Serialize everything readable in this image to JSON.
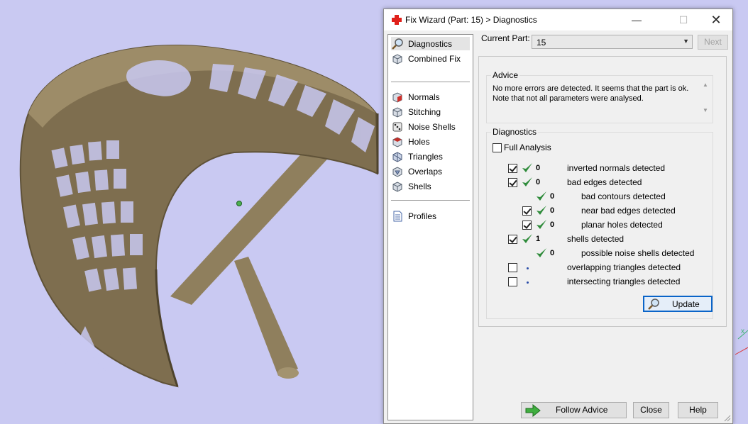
{
  "viewport": {
    "background": "#c9c9f2",
    "model_color": "#8a7a5a"
  },
  "dialog": {
    "title": "Fix Wizard (Part: 15) > Diagnostics",
    "icon": "red-cross-icon"
  },
  "nav": {
    "items": [
      {
        "label": "Diagnostics",
        "icon": "magnifier-icon",
        "selected": true
      },
      {
        "label": "Combined Fix",
        "icon": "cube-stack-icon"
      },
      {
        "label": "Normals",
        "icon": "cube-red-face-icon"
      },
      {
        "label": "Stitching",
        "icon": "cube-stitch-icon"
      },
      {
        "label": "Noise Shells",
        "icon": "dice-icon"
      },
      {
        "label": "Holes",
        "icon": "cube-hole-icon"
      },
      {
        "label": "Triangles",
        "icon": "triangle-cube-icon"
      },
      {
        "label": "Overlaps",
        "icon": "overlap-cube-icon"
      },
      {
        "label": "Shells",
        "icon": "shell-cube-icon"
      },
      {
        "label": "Profiles",
        "icon": "document-icon"
      }
    ]
  },
  "current_part": {
    "label": "Current Part:",
    "value": "15",
    "next_label": "Next"
  },
  "advice": {
    "title": "Advice",
    "text": "No more errors are detected. It seems that the part is ok.\nNote that not all parameters were analysed."
  },
  "diagnostics": {
    "title": "Diagnostics",
    "full_analysis_label": "Full Analysis",
    "full_analysis_checked": false,
    "rows": [
      {
        "checked": true,
        "ok": true,
        "count": "0",
        "label": "inverted normals detected"
      },
      {
        "checked": true,
        "ok": true,
        "count": "0",
        "label": "bad edges detected"
      },
      {
        "ok": true,
        "count": "0",
        "label": "bad contours detected"
      },
      {
        "checked": true,
        "ok": true,
        "count": "0",
        "label": "near bad edges detected"
      },
      {
        "checked": true,
        "ok": true,
        "count": "0",
        "label": "planar holes detected"
      },
      {
        "checked": true,
        "ok": true,
        "count": "1",
        "label": "shells detected"
      },
      {
        "ok": true,
        "count": "0",
        "label": "possible noise shells detected"
      },
      {
        "checked": false,
        "ok": false,
        "count": "",
        "label": "overlapping triangles detected"
      },
      {
        "checked": false,
        "ok": false,
        "count": "",
        "label": "intersecting triangles detected"
      }
    ],
    "update_label": "Update"
  },
  "footer": {
    "follow_label": "Follow Advice",
    "close_label": "Close",
    "help_label": "Help"
  },
  "colors": {
    "tick_green": "#2e8b3a",
    "accent_blue": "#0a64c8"
  }
}
